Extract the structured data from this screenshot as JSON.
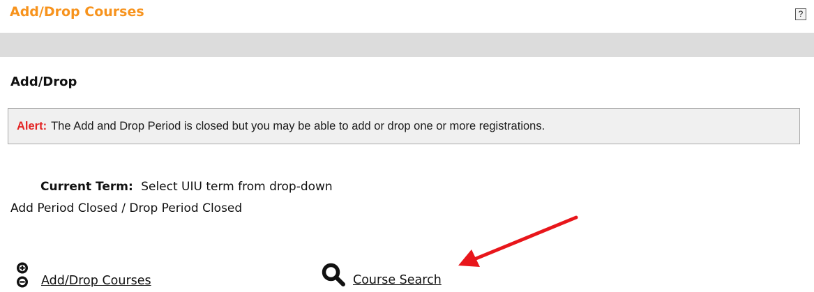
{
  "header": {
    "title": "Add/Drop Courses",
    "help_label": "?"
  },
  "section": {
    "heading": "Add/Drop"
  },
  "alert": {
    "label": "Alert:",
    "message": "The Add and Drop Period is closed but you may be able to add or drop one or more registrations."
  },
  "term": {
    "label": "Current Term:",
    "value": "Select UIU term from drop-down",
    "period_status": "Add Period Closed / Drop Period Closed"
  },
  "actions": {
    "add_drop_label": " Add/Drop Courses",
    "course_search_label": " Course Search"
  },
  "colors": {
    "title": "#f7931d",
    "alert_label": "#e32424",
    "annotation_arrow": "#e8161b",
    "bar": "#dcdcdc"
  },
  "icons": {
    "add_drop": "plus-minus-icon",
    "course_search": "search-icon",
    "annotation": "arrow-icon"
  }
}
